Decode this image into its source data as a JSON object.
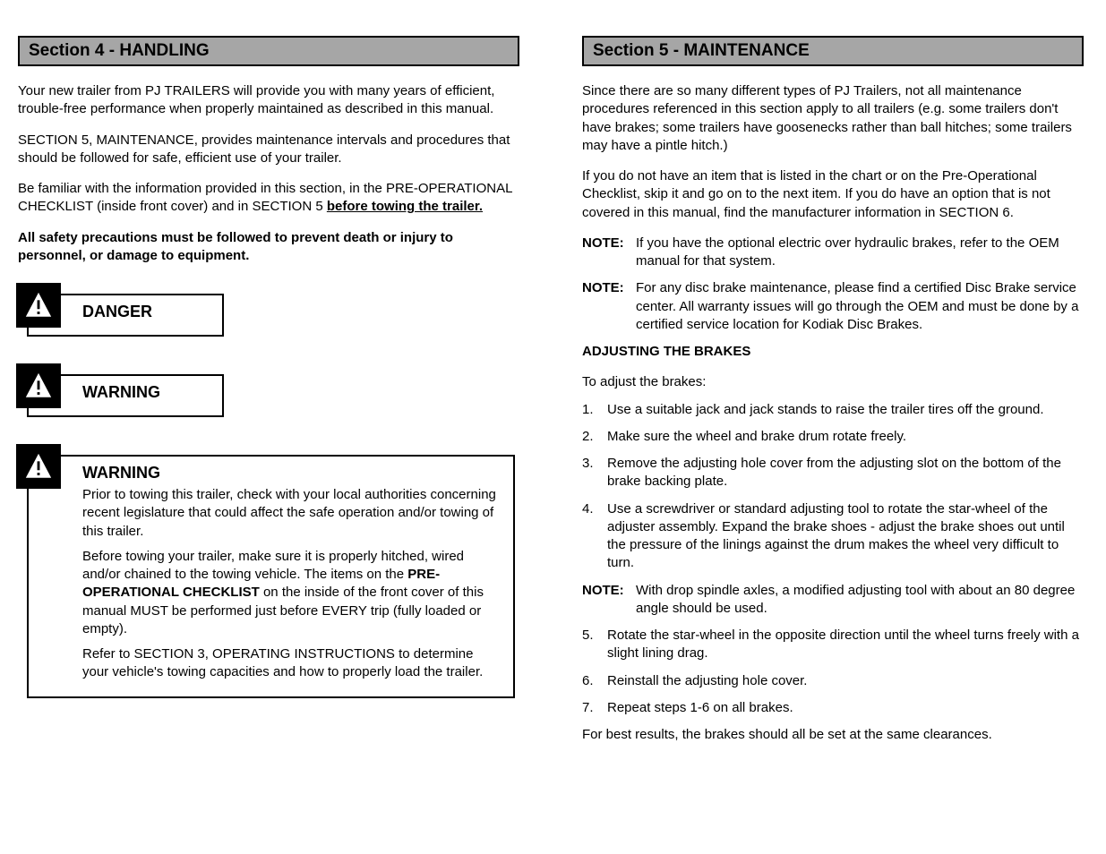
{
  "left": {
    "section_title": "Section 4 - HANDLING",
    "p1": "Your new trailer from PJ TRAILERS will provide you with many years of efficient, trouble-free performance when properly maintained as described in this manual.",
    "p2": "SECTION 5, MAINTENANCE, provides maintenance intervals and procedures that should be followed for safe, efficient use of your trailer.",
    "p3_pre": "Be familiar with the information provided in this section, in the PRE-OPERATIONAL CHECKLIST (inside front cover) and in SECTION 5 ",
    "p3_bold": "before towing the trailer.",
    "p4_bold": "All safety precautions must be followed to prevent death or injury to personnel, or damage to equipment.",
    "danger_label": "DANGER",
    "warning_label": "WARNING",
    "warn_p1": "Prior to towing this trailer, check with your local authorities concerning recent legislature that could affect the safe operation and/or towing of this trailer.",
    "warn_p2_pre": "Before towing your trailer, make sure it is properly hitched, wired and/or chained to the towing vehicle. The items on the ",
    "warn_p2_bold": "PRE-OPERATIONAL CHECKLIST",
    "warn_p2_post": " on the inside of the front cover of this manual MUST be performed just before EVERY trip (fully loaded or empty).",
    "warn_p3": "Refer to SECTION 3, OPERATING INSTRUCTIONS to determine your vehicle's towing capacities and how to properly load the trailer."
  },
  "right": {
    "section_title": "Section 5 - MAINTENANCE",
    "intro_p1": "Since there are so many different types of PJ Trailers, not all maintenance procedures referenced in this section apply to all trailers (e.g. some trailers don't have brakes; some trailers have goosenecks rather than ball hitches; some trailers may have a pintle hitch.)",
    "intro_p2": "If you do not have an item that is listed in the chart or on the Pre-Operational Checklist, skip it and go on to the next item. If you do have an option that is not covered in this manual, find the manufacturer information in SECTION 6.",
    "note_label": "NOTE:",
    "ul1": "If you have the optional electric over hydraulic brakes, refer to the OEM manual for that system.",
    "ul2": "For any disc brake maintenance, please find a certified Disc Brake service center. All warranty issues will go through the OEM and must be done by a certified service location for Kodiak Disc Brakes.",
    "adjust_title": "ADJUSTING THE BRAKES",
    "adjust_intro": "To adjust the brakes:",
    "steps": [
      "Use a suitable jack and jack stands to raise the trailer tires off the ground.",
      "Make sure the wheel and brake drum rotate freely.",
      "Remove the adjusting hole cover from the adjusting slot on the bottom of the brake backing plate.",
      "Use a screwdriver or standard adjusting tool to rotate the star-wheel of the adjuster assembly. Expand the brake shoes - adjust the brake shoes out until the pressure of the linings against the drum makes the wheel very difficult to turn."
    ],
    "step_note": "With drop spindle axles, a modified adjusting tool with about an 80 degree angle should be used.",
    "steps2": [
      {
        "n": "5.",
        "t": "Rotate the star-wheel in the opposite direction until the wheel turns freely with a slight lining drag."
      },
      {
        "n": "6.",
        "t": "Reinstall the adjusting hole cover."
      },
      {
        "n": "7.",
        "t": "Repeat steps 1-6 on all brakes."
      }
    ],
    "adjust_final": "For best results, the brakes should all be set at the same clearances."
  }
}
